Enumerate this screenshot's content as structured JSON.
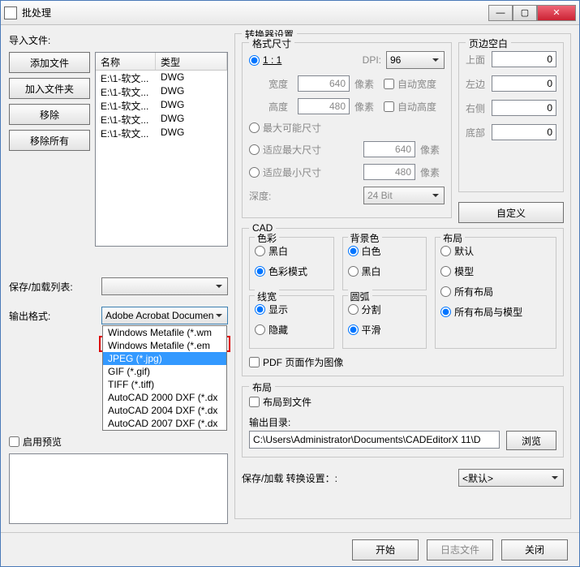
{
  "window": {
    "title": "批处理"
  },
  "left": {
    "import_label": "导入文件:",
    "btn_add_files": "添加文件",
    "btn_add_folder": "加入文件夹",
    "btn_remove": "移除",
    "btn_remove_all": "移除所有",
    "table": {
      "col_name": "名称",
      "col_type": "类型",
      "rows": [
        {
          "name": "E:\\1-软文...",
          "type": "DWG"
        },
        {
          "name": "E:\\1-软文...",
          "type": "DWG"
        },
        {
          "name": "E:\\1-软文...",
          "type": "DWG"
        },
        {
          "name": "E:\\1-软文...",
          "type": "DWG"
        },
        {
          "name": "E:\\1-软文...",
          "type": "DWG"
        }
      ]
    },
    "saveload_label": "保存/加载列表:",
    "saveload_value": "",
    "output_format_label": "输出格式:",
    "output_format_value": "Adobe Acrobat Documen",
    "dropdown": {
      "opt0": "Windows Metafile (*.wm",
      "opt1": "Windows Metafile (*.em",
      "opt2": "JPEG (*.jpg)",
      "opt3": "GIF (*.gif)",
      "opt4": "TIFF (*.tiff)",
      "opt5": "AutoCAD 2000 DXF (*.dx",
      "opt6": "AutoCAD 2004 DXF (*.dx",
      "opt7": "AutoCAD 2007 DXF (*.dx"
    },
    "enable_preview": "启用预览"
  },
  "right": {
    "converter_settings": "转换器设置",
    "format_size": "格式尺寸",
    "ratio_1_1": "1 : 1",
    "dpi_label": "DPI:",
    "dpi_value": "96",
    "width_label": "宽度",
    "width_value": "640",
    "px_unit": "像素",
    "auto_width": "自动宽度",
    "height_label": "高度",
    "height_value": "480",
    "auto_height": "自动高度",
    "max_possible": "最大可能尺寸",
    "fit_max": "适应最大尺寸",
    "fit_max_value": "640",
    "fit_min": "适应最小尺寸",
    "fit_min_value": "480",
    "depth_label": "深度:",
    "depth_value": "24 Bit",
    "margins": "页边空白",
    "margin_top_label": "上面",
    "margin_top_value": "0",
    "margin_left_label": "左边",
    "margin_left_value": "0",
    "margin_right_label": "右侧",
    "margin_right_value": "0",
    "margin_bottom_label": "底部",
    "margin_bottom_value": "0",
    "customize_btn": "自定义",
    "cad": "CAD",
    "color": "色彩",
    "color_bw": "黑白",
    "color_mode": "色彩模式",
    "bgcolor": "背景色",
    "bg_white": "白色",
    "bg_black": "黑白",
    "layout": "布局",
    "layout_default": "默认",
    "layout_model": "模型",
    "layout_all": "所有布局",
    "layout_all_model": "所有布局与模型",
    "linewidth": "线宽",
    "lw_show": "显示",
    "lw_hide": "隐藏",
    "arc": "圆弧",
    "arc_split": "分割",
    "arc_smooth": "平滑",
    "pdf_as_image": "PDF 页面作为图像",
    "layout_group": "布局",
    "layout_to_file": "布局到文件",
    "output_dir_label": "输出目录:",
    "output_dir_value": "C:\\Users\\Administrator\\Documents\\CADEditorX 11\\D",
    "browse_btn": "浏览",
    "saveload_settings_label": "保存/加载 转换设置：:",
    "saveload_settings_value": "<默认>"
  },
  "footer": {
    "start": "开始",
    "log_file": "日志文件",
    "close": "关闭"
  }
}
